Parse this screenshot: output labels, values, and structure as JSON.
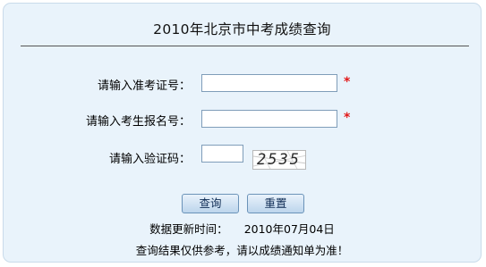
{
  "page": {
    "title": "2010年北京市中考成绩查询"
  },
  "form": {
    "admission_label": "请输入准考证号：",
    "admission_value": "",
    "registration_label": "请输入考生报名号：",
    "registration_value": "",
    "captcha_label": "请输入验证码：",
    "captcha_value": "",
    "captcha_code": "2535",
    "required_mark": "*"
  },
  "buttons": {
    "query_label": "查询",
    "reset_label": "重置"
  },
  "info": {
    "update_label": "数据更新时间：",
    "update_date": "2010年07月04日",
    "notice": "查询结果仅供参考，请以成绩通知单为准！"
  },
  "colors": {
    "panel_background": "#e9f3fb",
    "required_mark": "#e21818",
    "button_text": "#0f2c55"
  }
}
